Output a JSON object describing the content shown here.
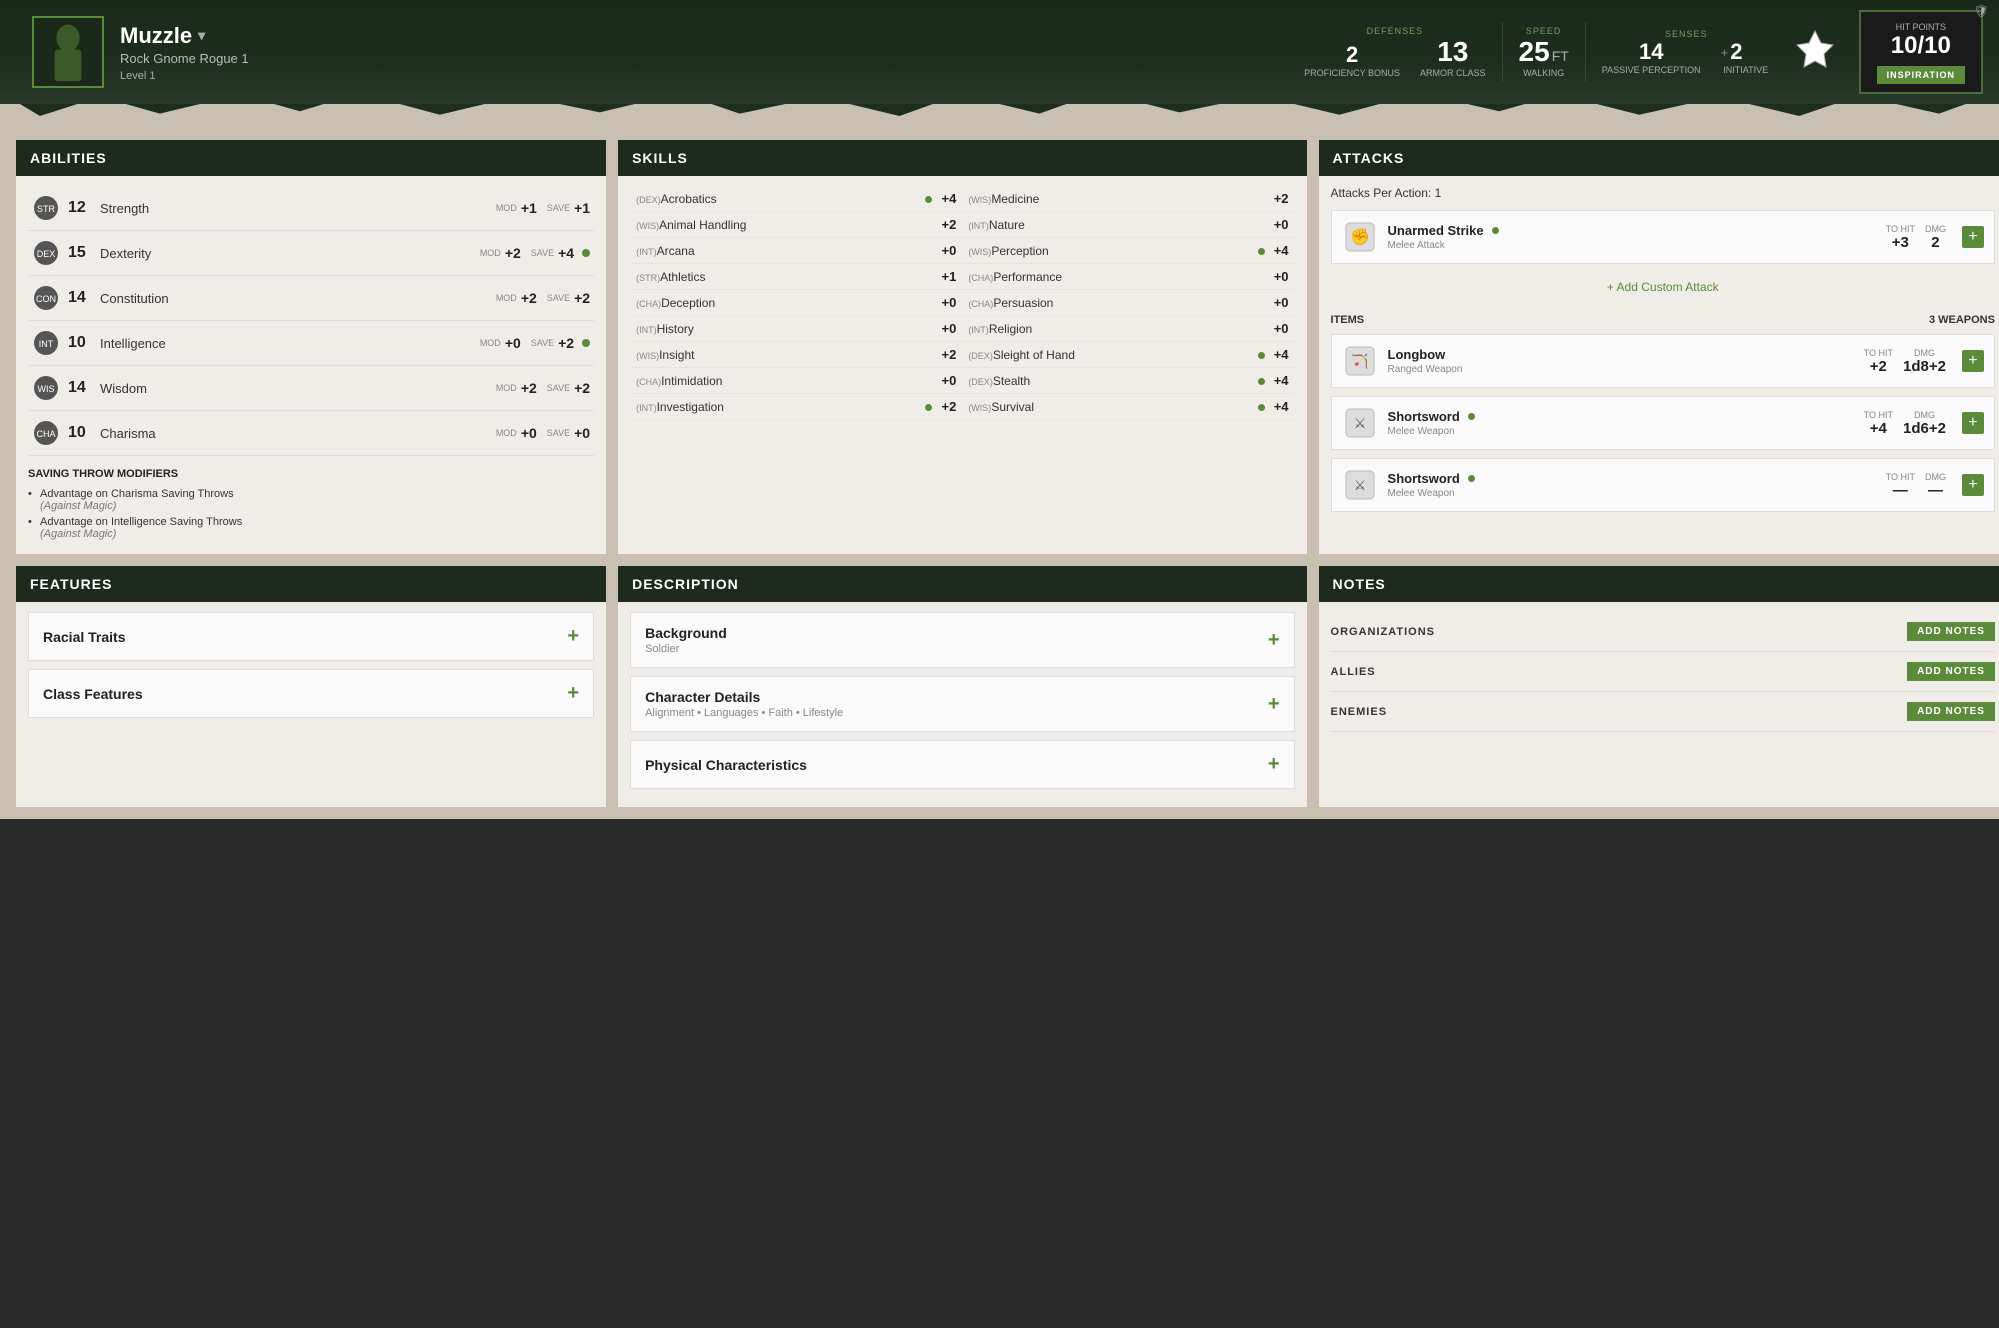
{
  "header": {
    "character_name": "Muzzle",
    "character_class": "Rock Gnome  Rogue 1",
    "character_level": "Level 1",
    "proficiency_bonus": "2",
    "proficiency_label": "PROFICIENCY BONUS",
    "armor_class": "13",
    "armor_label": "ARMOR CLASS",
    "walking_speed": "25",
    "speed_unit": "FT",
    "walking_label": "WALKING",
    "passive_perception": "14",
    "passive_label": "PASSIVE PERCEPTION",
    "initiative": "2",
    "initiative_label": "INITIATIVE",
    "hp_current": "10",
    "hp_max": "10",
    "hp_label": "HIT POINTS",
    "inspiration_label": "INSPIRATION",
    "defenses_label": "DEFENSES",
    "speed_label": "SPEED",
    "senses_label": "SENSES"
  },
  "abilities": {
    "title": "ABILITIES",
    "items": [
      {
        "score": "12",
        "name": "Strength",
        "mod_label": "MOD",
        "mod": "+1",
        "save_label": "SAVE",
        "save": "+1",
        "proficient": false
      },
      {
        "score": "15",
        "name": "Dexterity",
        "mod_label": "MOD",
        "mod": "+2",
        "save_label": "SAVE",
        "save": "+4",
        "proficient": true
      },
      {
        "score": "14",
        "name": "Constitution",
        "mod_label": "MOD",
        "mod": "+2",
        "save_label": "SAVE",
        "save": "+2",
        "proficient": false
      },
      {
        "score": "10",
        "name": "Intelligence",
        "mod_label": "MOD",
        "mod": "+0",
        "save_label": "SAVE",
        "save": "+2",
        "proficient": true
      },
      {
        "score": "14",
        "name": "Wisdom",
        "mod_label": "MOD",
        "mod": "+2",
        "save_label": "SAVE",
        "save": "+2",
        "proficient": false
      },
      {
        "score": "10",
        "name": "Charisma",
        "mod_label": "MOD",
        "mod": "+0",
        "save_label": "SAVE",
        "save": "+0",
        "proficient": false
      }
    ],
    "saving_throws_title": "SAVING THROW MODIFIERS",
    "saving_throws": [
      {
        "text": "Advantage on Charisma Saving Throws",
        "sub": "(Against Magic)"
      },
      {
        "text": "Advantage on Intelligence Saving Throws",
        "sub": "(Against Magic)"
      }
    ]
  },
  "skills": {
    "title": "SKILLS",
    "left_col": [
      {
        "attr": "(DEX)",
        "name": "Acrobatics",
        "proficient": true,
        "val": "+4"
      },
      {
        "attr": "(WIS)",
        "name": "Animal Handling",
        "proficient": false,
        "val": "+2"
      },
      {
        "attr": "(INT)",
        "name": "Arcana",
        "proficient": false,
        "val": "+0"
      },
      {
        "attr": "(STR)",
        "name": "Athletics",
        "proficient": false,
        "val": "+1"
      },
      {
        "attr": "(CHA)",
        "name": "Deception",
        "proficient": false,
        "val": "+0"
      },
      {
        "attr": "(INT)",
        "name": "History",
        "proficient": false,
        "val": "+0"
      },
      {
        "attr": "(WIS)",
        "name": "Insight",
        "proficient": false,
        "val": "+2"
      },
      {
        "attr": "(CHA)",
        "name": "Intimidation",
        "proficient": false,
        "val": "+0"
      },
      {
        "attr": "(INT)",
        "name": "Investigation",
        "proficient": true,
        "val": "+2"
      }
    ],
    "right_col": [
      {
        "attr": "(WIS)",
        "name": "Medicine",
        "proficient": false,
        "val": "+2"
      },
      {
        "attr": "(INT)",
        "name": "Nature",
        "proficient": false,
        "val": "+0"
      },
      {
        "attr": "(WIS)",
        "name": "Perception",
        "proficient": true,
        "val": "+4"
      },
      {
        "attr": "(CHA)",
        "name": "Performance",
        "proficient": false,
        "val": "+0"
      },
      {
        "attr": "(CHA)",
        "name": "Persuasion",
        "proficient": false,
        "val": "+0"
      },
      {
        "attr": "(INT)",
        "name": "Religion",
        "proficient": false,
        "val": "+0"
      },
      {
        "attr": "(DEX)",
        "name": "Sleight of Hand",
        "proficient": true,
        "val": "+4"
      },
      {
        "attr": "(DEX)",
        "name": "Stealth",
        "proficient": true,
        "val": "+4"
      },
      {
        "attr": "(WIS)",
        "name": "Survival",
        "proficient": true,
        "val": "+4"
      }
    ]
  },
  "attacks": {
    "title": "ATTACKS",
    "attacks_per_action": "Attacks Per Action: 1",
    "items": [
      {
        "name": "Unarmed Strike",
        "type": "Melee Attack",
        "proficient": true,
        "to_hit_label": "TO HIT",
        "to_hit": "+3",
        "dmg_label": "DMG",
        "dmg": "2"
      }
    ],
    "add_custom_label": "+ Add Custom Attack",
    "items_title": "ITEMS",
    "items_count": "3 WEAPONS",
    "weapons": [
      {
        "name": "Longbow",
        "type": "Ranged Weapon",
        "to_hit": "+2",
        "dmg": "1d8+2"
      },
      {
        "name": "Shortsword",
        "type": "Melee Weapon",
        "proficient": true,
        "to_hit": "+4",
        "dmg": "1d6+2"
      },
      {
        "name": "Shortsword",
        "type": "Melee Weapon",
        "proficient": true,
        "to_hit": "",
        "dmg": ""
      }
    ]
  },
  "features": {
    "title": "FEATURES",
    "items": [
      {
        "label": "Racial Traits"
      },
      {
        "label": "Class Features"
      }
    ]
  },
  "description": {
    "title": "DESCRIPTION",
    "items": [
      {
        "label": "Background",
        "sub": "Soldier"
      },
      {
        "label": "Character Details",
        "sub": "Alignment  •  Languages  •  Faith  •  Lifestyle"
      },
      {
        "label": "Physical Characteristics",
        "sub": ""
      }
    ]
  },
  "notes": {
    "title": "NOTES",
    "sections": [
      {
        "label": "ORGANIZATIONS",
        "btn": "ADD NOTES"
      },
      {
        "label": "ALLIES",
        "btn": "ADD NOTES"
      },
      {
        "label": "ENEMIES",
        "btn": "ADD NOTES"
      }
    ]
  }
}
